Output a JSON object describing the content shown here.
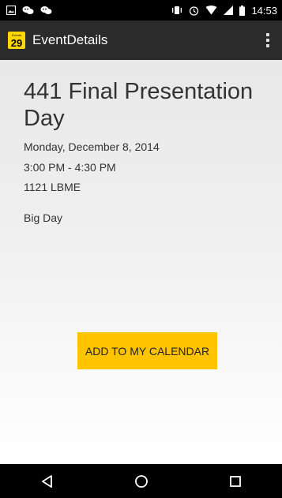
{
  "status_bar": {
    "time": "14:53",
    "left_icons": [
      "image-icon",
      "chat-icon",
      "chat-icon"
    ],
    "right_icons": [
      "vibrate-icon",
      "alarm-icon",
      "wifi-icon",
      "signal-icon",
      "battery-icon"
    ]
  },
  "app_bar": {
    "icon_header": "Events",
    "icon_number": "29",
    "title": "EventDetails",
    "menu_icon": "overflow-menu-icon"
  },
  "event": {
    "title": "441 Final Presentation Day",
    "date": "Monday, December 8, 2014",
    "time": "3:00 PM - 4:30 PM",
    "location": "1121 LBME",
    "description": "Big Day"
  },
  "actions": {
    "add_to_calendar_label": "ADD TO MY CALENDAR"
  },
  "nav_bar": {
    "buttons": [
      "back-icon",
      "home-icon",
      "recents-icon"
    ]
  },
  "colors": {
    "accent": "#ffc400",
    "app_bar": "#2b2b2b",
    "icon_bg": "#ffd600"
  }
}
